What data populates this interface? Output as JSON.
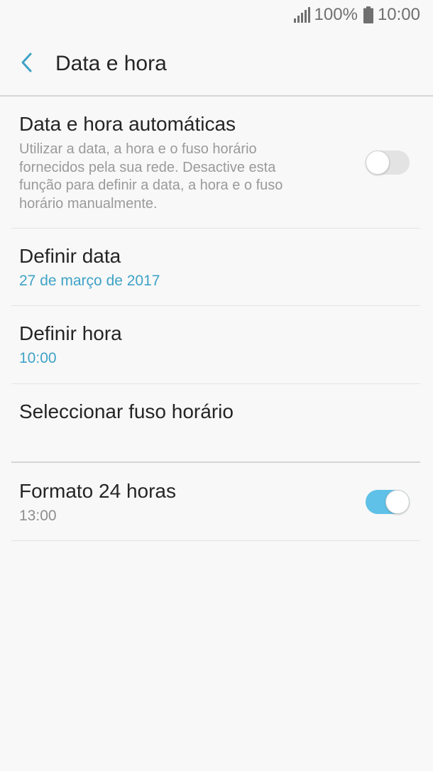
{
  "status_bar": {
    "battery": "100%",
    "time": "10:00",
    "icons": [
      "signal-icon",
      "battery-icon"
    ],
    "color": "#707070"
  },
  "header": {
    "title": "Data e hora",
    "back_icon": "chevron-left-icon",
    "accent_color": "#3fa2c6"
  },
  "settings": {
    "auto_datetime": {
      "title": "Data e hora automáticas",
      "description": "Utilizar a data, a hora e o fuso horário fornecidos pela sua rede. Desactive esta função para definir a data, a hora e o fuso horário manualmente.",
      "enabled": false
    },
    "set_date": {
      "title": "Definir data",
      "value": "27 de março de 2017"
    },
    "set_time": {
      "title": "Definir hora",
      "value": "10:00"
    },
    "timezone": {
      "title": "Seleccionar fuso horário"
    },
    "format_24h": {
      "title": "Formato 24 horas",
      "value": "13:00",
      "enabled": true
    }
  },
  "colors": {
    "background": "#f8f8f8",
    "accent": "#3fa2c6",
    "toggle_on": "#5fc1e7",
    "toggle_off": "#e3e3e3",
    "secondary_text": "#9a9a9a"
  }
}
